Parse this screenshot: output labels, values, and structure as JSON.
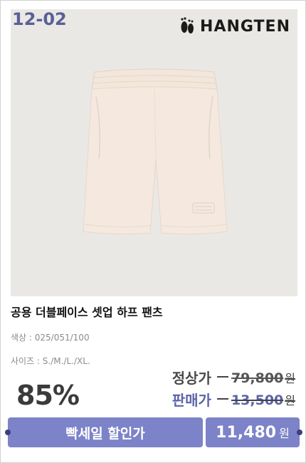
{
  "badge": {
    "date": "12-02"
  },
  "brand": {
    "name": "HANGTEN"
  },
  "product": {
    "title": "공용 더블페이스 셋업 하프 팬츠",
    "color_label": "색상",
    "color_value": ": 025/051/100",
    "size_label": "사이즈",
    "size_value": ": S./M./L./XL."
  },
  "pricing": {
    "discount": "85%",
    "regular_label": "정상가",
    "regular_price": "79,800",
    "sale_label": "판매가",
    "sale_price": "13,500",
    "currency": "원"
  },
  "promo": {
    "label": "빡세일 할인가",
    "final_price": "11,480",
    "currency": "원"
  },
  "colors": {
    "accent": "#7c83c8",
    "badge": "#5a5f96",
    "photo_bg": "#e9e8e4",
    "garment": "#f4e8de"
  }
}
